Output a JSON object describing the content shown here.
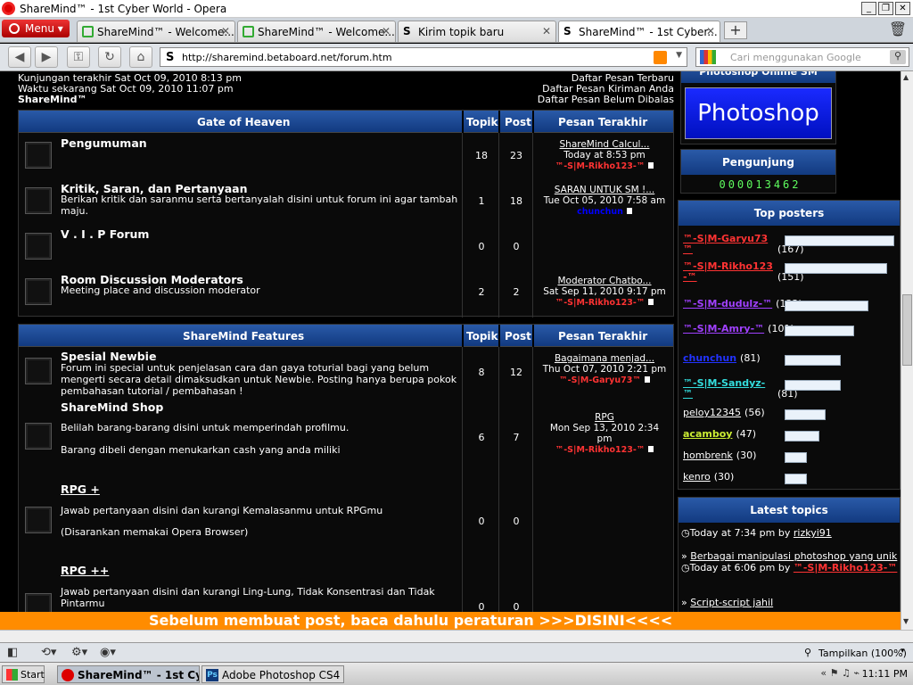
{
  "window": {
    "title": "ShareMind™ - 1st Cyber World - Opera"
  },
  "browser": {
    "menu_label": "Menu",
    "tabs": [
      {
        "label": "ShareMind™ - Welcome...",
        "icon": "chat-icon"
      },
      {
        "label": "ShareMind™ - Welcome...",
        "icon": "chat-icon"
      },
      {
        "label": "Kirim topik baru",
        "icon": "s-icon"
      },
      {
        "label": "ShareMind™ - 1st Cyber...",
        "icon": "s-icon"
      }
    ],
    "url": "http://sharemind.betaboard.net/forum.htm",
    "search_placeholder": "Cari menggunakan Google",
    "zoom_label": "Tampilkan (100%)"
  },
  "info": {
    "last_visit": "Kunjungan terakhir Sat Oct 09, 2010 8:13 pm",
    "now": "Waktu sekarang Sat Oct 09, 2010 11:07 pm",
    "site": "ShareMind™",
    "links": [
      "Daftar Pesan Terbaru",
      "Daftar Pesan Kiriman Anda",
      "Daftar Pesan Belum Dibalas"
    ]
  },
  "columns": {
    "topics": "Topik",
    "posts": "Post",
    "last": "Pesan Terakhir"
  },
  "cat1": {
    "title": "Gate of Heaven",
    "forums": [
      {
        "title": "Pengumuman",
        "desc": "",
        "topics": "18",
        "posts": "23",
        "last_title": "ShareMind Calcul...",
        "last_date": "Today at 8:53 pm",
        "last_user": "™-S|M-Rikho123-™"
      },
      {
        "title": "Kritik, Saran, dan Pertanyaan",
        "desc": "Berikan kritik dan saranmu serta bertanyalah disini untuk forum ini agar tambah maju.",
        "topics": "1",
        "posts": "18",
        "last_title": "SARAN UNTUK SM !...",
        "last_date": "Tue Oct 05, 2010 7:58 am",
        "last_user": "chunchun"
      },
      {
        "title": "V . I . P Forum",
        "desc": "",
        "topics": "0",
        "posts": "0",
        "last_title": "",
        "last_date": "",
        "last_user": ""
      },
      {
        "title": "Room Discussion Moderators",
        "desc": "Meeting place and discussion moderator",
        "topics": "2",
        "posts": "2",
        "last_title": "Moderator Chatbo...",
        "last_date": "Sat Sep 11, 2010 9:17 pm",
        "last_user": "™-S|M-Rikho123-™"
      }
    ]
  },
  "cat2": {
    "title": "ShareMind Features",
    "forums": [
      {
        "title": "Spesial Newbie",
        "desc": "Forum ini special untuk penjelasan cara dan gaya toturial bagi yang belum mengerti secara detail dimaksudkan untuk Newbie. Posting hanya berupa pokok pembahasan tutorial / pembahasan !",
        "topics": "8",
        "posts": "12",
        "last_title": "Bagaimana menjad...",
        "last_date": "Thu Oct 07, 2010 2:21 pm",
        "last_user": "™-S|M-Garyu73™"
      },
      {
        "title": "ShareMind Shop",
        "desc1": "Belilah barang-barang disini untuk memperindah profilmu.",
        "desc2": "Barang dibeli dengan menukarkan cash yang anda miliki",
        "topics": "6",
        "posts": "7",
        "last_title": "RPG",
        "last_date": "Mon Sep 13, 2010 2:34 pm",
        "last_user": "™-S|M-Rikho123-™"
      },
      {
        "title": "RPG +",
        "desc1": "Jawab pertanyaan disini dan kurangi Kemalasanmu untuk RPGmu",
        "desc2": "(Disarankan memakai Opera Browser)",
        "topics": "0",
        "posts": "0"
      },
      {
        "title": "RPG ++",
        "desc1": "Jawab pertanyaan disini dan kurangi Ling-Lung, Tidak Konsentrasi dan Tidak Pintarmu",
        "topics": "0",
        "posts": "0"
      }
    ]
  },
  "sidebar": {
    "photoshop_header": "Photoshop Online SM",
    "photoshop_banner": "Photoshop",
    "visitors_header": "Pengunjung",
    "visitors_count": "000013462",
    "top_posters_header": "Top posters",
    "posters": [
      {
        "name": "™-S|M-Garyu73™",
        "count": "(167)",
        "color": "#ff3333",
        "fill": 0.92
      },
      {
        "name": "™-S|M-Rikho123-™",
        "count": "(151)",
        "color": "#ff3333",
        "fill": 0.86
      },
      {
        "name": "™-S|M-dudulz-™",
        "count": "(122)",
        "color": "#a040ff",
        "fill": 0.7
      },
      {
        "name": "™-S|M-Amry-™",
        "count": "(101)",
        "color": "#a040ff",
        "fill": 0.58
      },
      {
        "name": "chunchun",
        "count": "(81)",
        "color": "#2233ff",
        "fill": 0.47
      },
      {
        "name": "™-S|M-Sandyz-™",
        "count": "(81)",
        "color": "#33dddd",
        "fill": 0.47
      },
      {
        "name": "peloy12345",
        "count": "(56)",
        "color": "#ffffff",
        "fill": 0.34
      },
      {
        "name": "acamboy",
        "count": "(47)",
        "color": "#ccee33",
        "fill": 0.29
      },
      {
        "name": "hombrenk",
        "count": "(30)",
        "color": "#ffffff",
        "fill": 0.19
      },
      {
        "name": "kenro",
        "count": "(30)",
        "color": "#ffffff",
        "fill": 0.19
      }
    ],
    "latest_header": "Latest topics",
    "latest": [
      {
        "time": "Today at 7:34 pm by",
        "user": "rizkyi91",
        "title": "Berbagai manipulasi photoshop yang unik"
      },
      {
        "time": "Today at 6:06 pm by",
        "user": "™-S|M-Rikho123-™",
        "title": "Script-script jahil"
      }
    ]
  },
  "marquee": "Sebelum membuat post, baca dahulu peraturan >>>DISINI<<<<",
  "taskbar": {
    "start": "Start",
    "items": [
      "ShareMind™ - 1st Cyber...",
      "Adobe Photoshop CS4"
    ],
    "clock": "11:11 PM"
  }
}
